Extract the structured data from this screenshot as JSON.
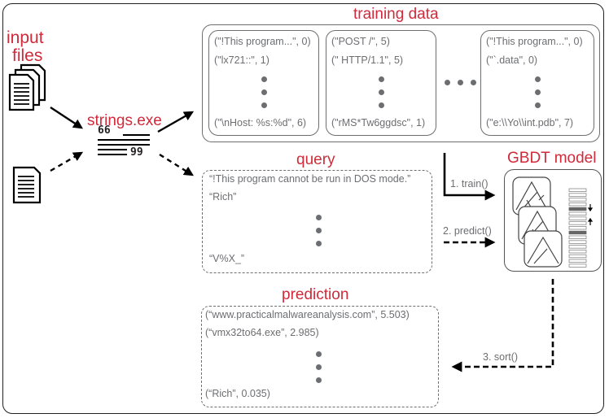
{
  "labels": {
    "input_files_line1": "input",
    "input_files_line2": "files",
    "strings_exe": "strings.exe",
    "training_data": "training data",
    "query": "query",
    "gbdt_model": "GBDT model",
    "prediction": "prediction"
  },
  "steps": {
    "train": "1. train()",
    "predict": "2. predict()",
    "sort": "3. sort()"
  },
  "training_data": {
    "sets": [
      {
        "first": "(\"!This program...\", 0)",
        "second": "(\"lx721::\", 1)",
        "last": "(\"\\nHost: %s:%d\", 6)"
      },
      {
        "first": "(\"POST /\", 5)",
        "second": "(\" HTTP/1.1\", 5)",
        "last": "(\"rMS*Tw6ggdsc\", 1)"
      },
      {
        "first": "(\"!This program...\", 0)",
        "second": "(\"`.data\", 0)",
        "last": "(\"e:\\\\Yo\\\\int.pdb\", 7)"
      }
    ]
  },
  "query": {
    "first": "“!This program cannot be run in DOS mode.”",
    "second": "“Rich”",
    "last": "“V%X_”"
  },
  "prediction": {
    "first": "(“www.practicalmalwareanalysis.com”, 5.503)",
    "second": "(“vmx32to64.exe”, 2.985)",
    "last": "(“Rich”, 0.035)"
  },
  "strings_icon": {
    "top_glyph": "66",
    "bottom_glyph": "99"
  },
  "colors": {
    "accent": "#d12a3a",
    "text_gray": "#6d6e71",
    "line": "#231f20"
  }
}
